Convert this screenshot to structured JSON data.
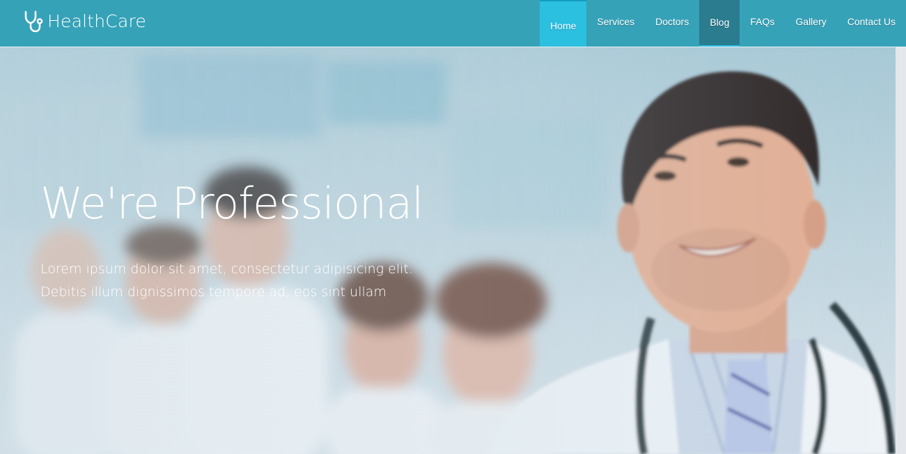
{
  "brand": {
    "name": "HealthCare",
    "icon": "stethoscope-icon"
  },
  "nav": {
    "items": [
      {
        "label": "Home",
        "state": "active"
      },
      {
        "label": "Services",
        "state": "normal"
      },
      {
        "label": "Doctors",
        "state": "normal"
      },
      {
        "label": "Blog",
        "state": "hover"
      },
      {
        "label": "FAQs",
        "state": "normal"
      },
      {
        "label": "Gallery",
        "state": "normal"
      },
      {
        "label": "Contact Us",
        "state": "normal"
      }
    ]
  },
  "hero": {
    "title": "We're Professional",
    "text": "Lorem ipsum dolor sit amet, consectetur adipisicing elit. Debitis illum dignissimos tempore ad, eos sint ullam"
  },
  "colors": {
    "navbar": "#36a2b8",
    "nav_active": "#2bbfe0",
    "nav_hover": "#2b7c8f",
    "hero_text": "#ffffff"
  }
}
